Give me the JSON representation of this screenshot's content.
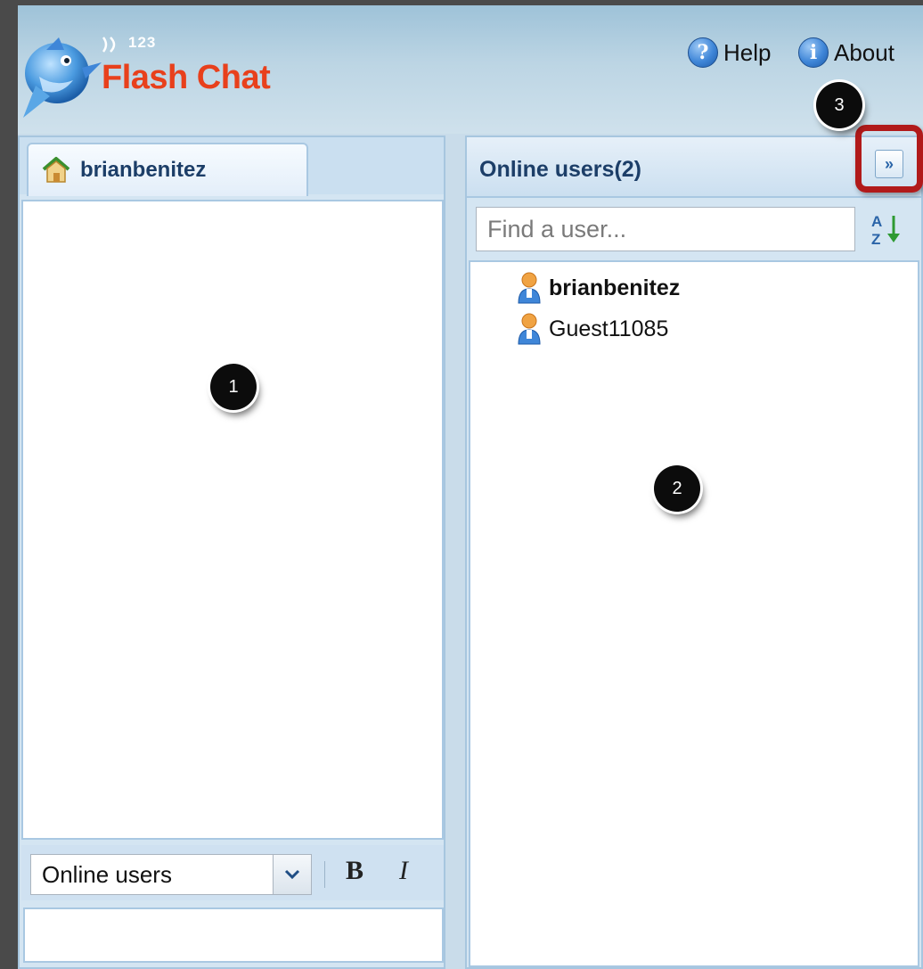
{
  "header": {
    "logo": {
      "number": "123",
      "title": "Flash Chat"
    },
    "help_label": "Help",
    "about_label": "About"
  },
  "chat": {
    "active_tab": "brianbenitez",
    "recipient_select": {
      "selected": "Online users"
    },
    "format": {
      "bold": "B",
      "italic": "I"
    }
  },
  "users_panel": {
    "title": "Online users(2)",
    "collapse_button": "»",
    "search_placeholder": "Find a user...",
    "users": [
      {
        "name": "brianbenitez",
        "is_self": true
      },
      {
        "name": "Guest11085",
        "is_self": false
      }
    ]
  },
  "annotations": [
    "1",
    "2",
    "3"
  ],
  "colors": {
    "brand_red": "#e8401c",
    "header_blue": "#bcd5e4",
    "panel_border": "#a9c8e2",
    "title_text": "#1c3e68",
    "highlight_red": "#b11a1a"
  }
}
